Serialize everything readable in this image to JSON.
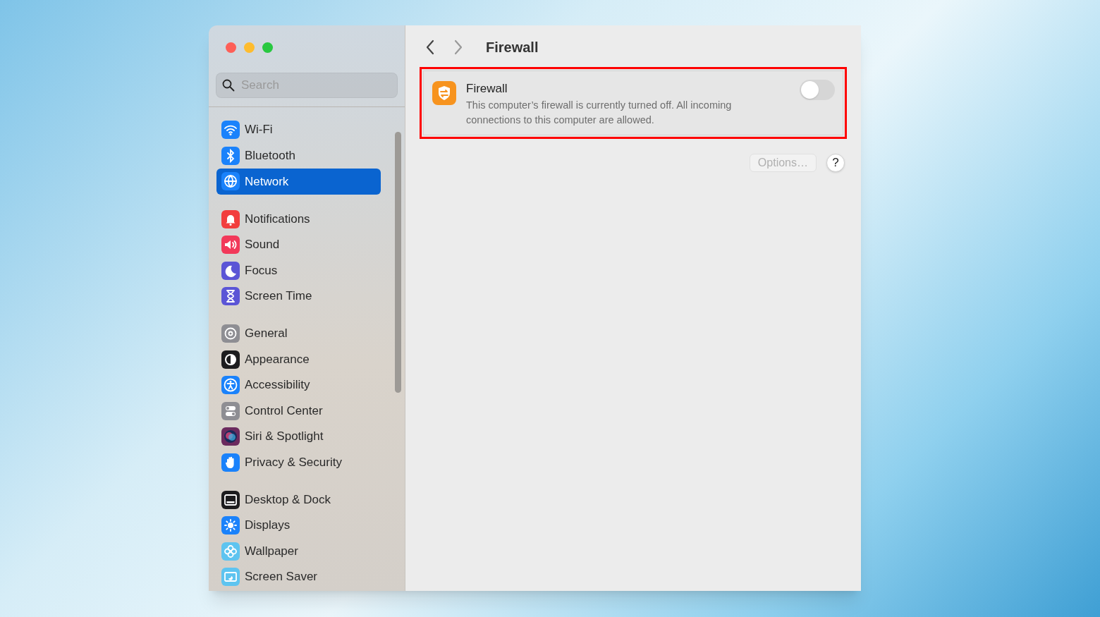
{
  "window": {
    "title": "Firewall"
  },
  "search": {
    "placeholder": "Search"
  },
  "sidebar": {
    "groups": [
      [
        {
          "label": "Wi-Fi",
          "selected": false,
          "color": "#1a82fb"
        },
        {
          "label": "Bluetooth",
          "selected": false,
          "color": "#1a82fb"
        },
        {
          "label": "Network",
          "selected": true,
          "color": "#1a82fb"
        }
      ],
      [
        {
          "label": "Notifications",
          "selected": false,
          "color": "#f23d3d"
        },
        {
          "label": "Sound",
          "selected": false,
          "color": "#f2395a"
        },
        {
          "label": "Focus",
          "selected": false,
          "color": "#5b55d6"
        },
        {
          "label": "Screen Time",
          "selected": false,
          "color": "#5b55d6"
        }
      ],
      [
        {
          "label": "General",
          "selected": false,
          "color": "#8e8e93"
        },
        {
          "label": "Appearance",
          "selected": false,
          "color": "#1c1c1e"
        },
        {
          "label": "Accessibility",
          "selected": false,
          "color": "#1a82fb"
        },
        {
          "label": "Control Center",
          "selected": false,
          "color": "#8e8e93"
        },
        {
          "label": "Siri & Spotlight",
          "selected": false,
          "color": "#6b2a5e"
        },
        {
          "label": "Privacy & Security",
          "selected": false,
          "color": "#1a82fb"
        }
      ],
      [
        {
          "label": "Desktop & Dock",
          "selected": false,
          "color": "#1c1c1e"
        },
        {
          "label": "Displays",
          "selected": false,
          "color": "#1a82fb"
        },
        {
          "label": "Wallpaper",
          "selected": false,
          "color": "#5ec4f0"
        },
        {
          "label": "Screen Saver",
          "selected": false,
          "color": "#5ec4f0"
        }
      ]
    ]
  },
  "firewall": {
    "highlighted": true,
    "title": "Firewall",
    "description": "This computer’s firewall is currently turned off. All incoming connections to this computer are allowed.",
    "on": false
  },
  "options_button": {
    "label": "Options…",
    "disabled": true
  },
  "help_button": {
    "label": "?"
  }
}
